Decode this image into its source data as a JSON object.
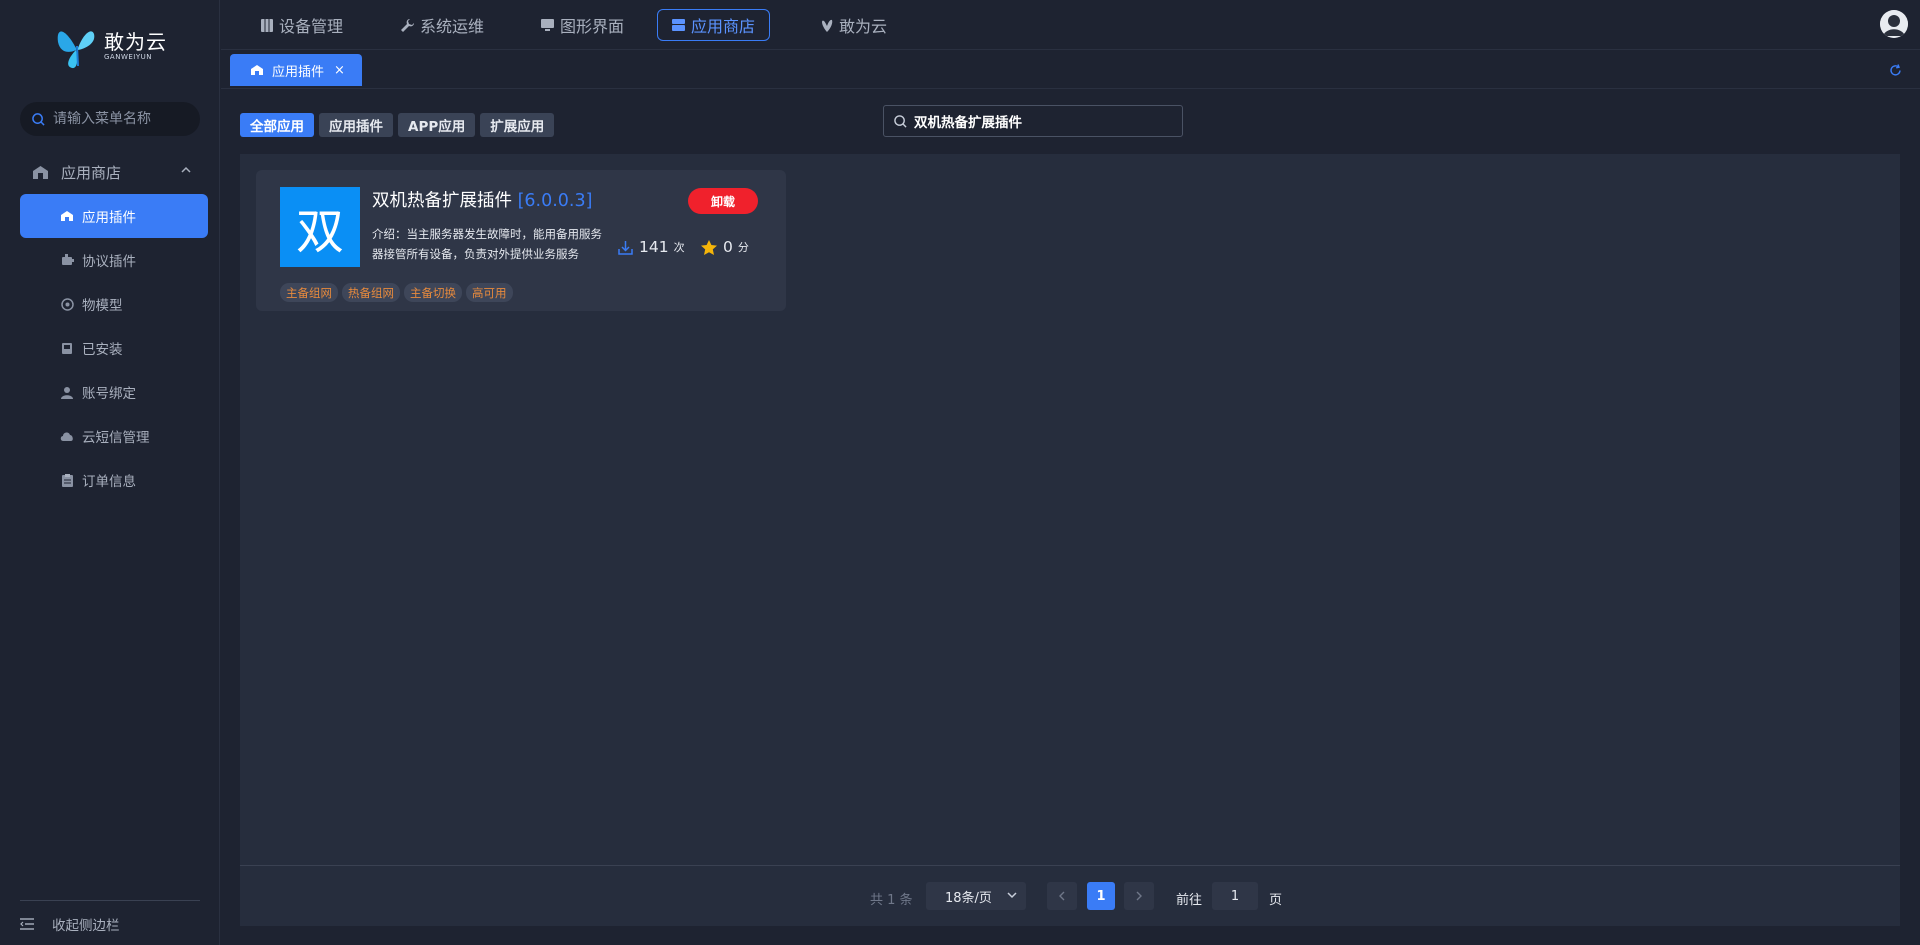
{
  "brand": {
    "name_cn": "敢为云",
    "name_en": "GANWEIYUN"
  },
  "sidebar": {
    "search_placeholder": "请输入菜单名称",
    "group_label": "应用商店",
    "items": [
      {
        "label": "应用插件",
        "icon": "store-icon",
        "active": true
      },
      {
        "label": "协议插件",
        "icon": "plugin-icon"
      },
      {
        "label": "物模型",
        "icon": "model-icon"
      },
      {
        "label": "已安装",
        "icon": "installed-icon"
      },
      {
        "label": "账号绑定",
        "icon": "user-icon"
      },
      {
        "label": "云短信管理",
        "icon": "cloud-icon"
      },
      {
        "label": "订单信息",
        "icon": "clipboard-icon"
      }
    ],
    "collapse_label": "收起侧边栏"
  },
  "topnav": [
    {
      "label": "设备管理",
      "icon": "device-icon"
    },
    {
      "label": "系统运维",
      "icon": "wrench-icon"
    },
    {
      "label": "图形界面",
      "icon": "monitor-icon"
    },
    {
      "label": "应用商店",
      "icon": "store-icon",
      "active": true
    },
    {
      "label": "敢为云",
      "icon": "cloud-logo-icon"
    }
  ],
  "tab": {
    "label": "应用插件",
    "close": "×"
  },
  "filters": [
    "全部应用",
    "应用插件",
    "APP应用",
    "扩展应用"
  ],
  "app_search": {
    "value": "双机热备扩展插件"
  },
  "apps": [
    {
      "icon_char": "双",
      "name": "双机热备扩展插件",
      "version": "[6.0.0.3]",
      "description": "介绍：当主服务器发生故障时，能用备用服务器接管所有设备，负责对外提供业务服务",
      "uninstall_label": "卸载",
      "downloads": "141",
      "downloads_unit": "次",
      "rating": "0",
      "rating_unit": "分",
      "tags": [
        "主备组网",
        "热备组网",
        "主备切换",
        "高可用"
      ]
    }
  ],
  "pagination": {
    "total_text": "共 1 条",
    "page_size": "18条/页",
    "current_page": "1",
    "goto_label": "前往",
    "goto_value": "1",
    "page_unit": "页"
  },
  "colors": {
    "accent": "#3a7cf6",
    "danger": "#f0212c",
    "tag_text": "#e78a3d",
    "app_icon_bg": "#0a8ff5"
  }
}
